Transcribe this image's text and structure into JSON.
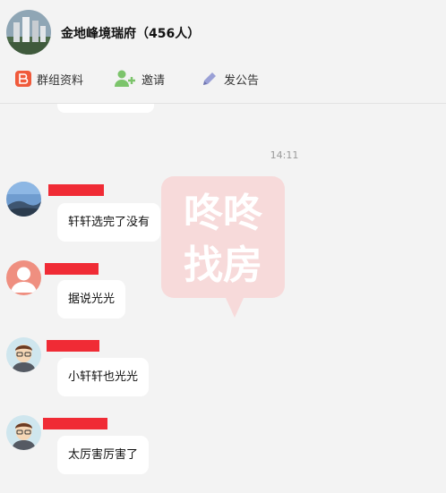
{
  "header": {
    "group_name": "金地峰境瑞府（456人）",
    "actions": [
      {
        "label": "群组资料",
        "icon": "group-profile-icon",
        "color": "#f05a3b"
      },
      {
        "label": "邀请",
        "icon": "add-user-icon",
        "color": "#7cc46b"
      },
      {
        "label": "发公告",
        "icon": "pencil-icon",
        "color": "#9aa0d6"
      }
    ]
  },
  "chat": {
    "timestamp": "14:11",
    "watermark": [
      "咚咚",
      "找房"
    ],
    "messages": [
      {
        "avatar": "landscape-photo-avatar",
        "text": "轩轩选完了没有"
      },
      {
        "avatar": "default-user-avatar",
        "text": "据说光光"
      },
      {
        "avatar": "cartoon-man-avatar",
        "text": "小轩轩也光光"
      },
      {
        "avatar": "cartoon-man-avatar",
        "text": "太厉害厉害了"
      }
    ]
  },
  "colors": {
    "background": "#f3f3f3",
    "bubble": "#ffffff",
    "redaction": "#f02b35"
  }
}
